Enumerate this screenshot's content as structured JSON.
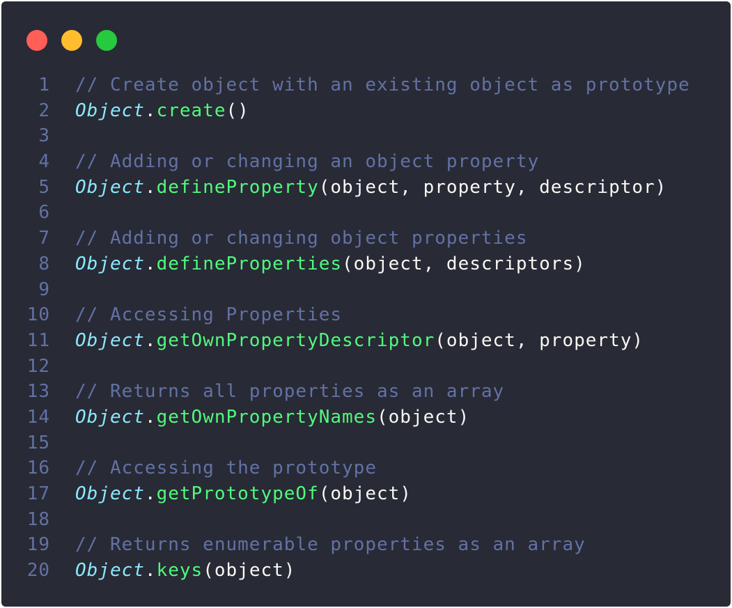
{
  "window": {
    "controls": [
      {
        "name": "close",
        "color": "#ff5f56"
      },
      {
        "name": "minimize",
        "color": "#ffbd2e"
      },
      {
        "name": "maximize",
        "color": "#27c93f"
      }
    ]
  },
  "code": {
    "lines": [
      {
        "num": "1",
        "comment": "// Create object with an existing object as prototype"
      },
      {
        "num": "2",
        "obj": "Object",
        "dot": ".",
        "fn": "create",
        "args": "()"
      },
      {
        "num": "3"
      },
      {
        "num": "4",
        "comment": "// Adding or changing an object property"
      },
      {
        "num": "5",
        "obj": "Object",
        "dot": ".",
        "fn": "defineProperty",
        "args": "(object, property, descriptor)"
      },
      {
        "num": "6"
      },
      {
        "num": "7",
        "comment": "// Adding or changing object properties"
      },
      {
        "num": "8",
        "obj": "Object",
        "dot": ".",
        "fn": "defineProperties",
        "args": "(object, descriptors)"
      },
      {
        "num": "9"
      },
      {
        "num": "10",
        "comment": "// Accessing Properties"
      },
      {
        "num": "11",
        "obj": "Object",
        "dot": ".",
        "fn": "getOwnPropertyDescriptor",
        "args": "(object, property)"
      },
      {
        "num": "12"
      },
      {
        "num": "13",
        "comment": "// Returns all properties as an array"
      },
      {
        "num": "14",
        "obj": "Object",
        "dot": ".",
        "fn": "getOwnPropertyNames",
        "args": "(object)"
      },
      {
        "num": "15"
      },
      {
        "num": "16",
        "comment": "// Accessing the prototype"
      },
      {
        "num": "17",
        "obj": "Object",
        "dot": ".",
        "fn": "getPrototypeOf",
        "args": "(object)"
      },
      {
        "num": "18"
      },
      {
        "num": "19",
        "comment": "// Returns enumerable properties as an array"
      },
      {
        "num": "20",
        "obj": "Object",
        "dot": ".",
        "fn": "keys",
        "args": "(object)"
      }
    ]
  }
}
